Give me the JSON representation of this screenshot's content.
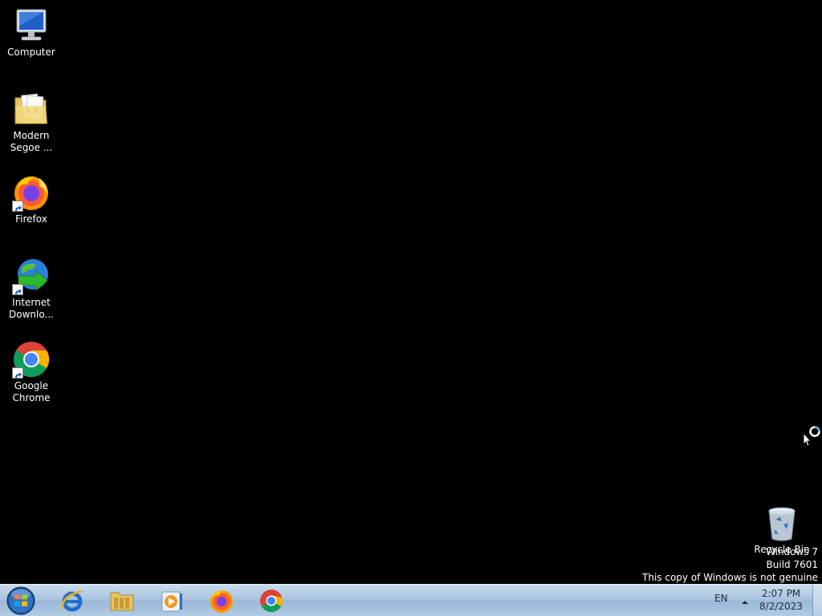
{
  "desktop_icons": [
    {
      "label": "Computer",
      "icon": "computer-icon"
    },
    {
      "label": "Modern\nSegoe ...",
      "icon": "folder-icon"
    },
    {
      "label": "Firefox",
      "icon": "firefox-icon"
    },
    {
      "label": "Internet\nDownlo...",
      "icon": "internet-download-manager-icon"
    },
    {
      "label": "Google\nChrome",
      "icon": "chrome-icon"
    },
    {
      "label": "Recycle Bin",
      "icon": "recycle-bin-icon"
    }
  ],
  "watermark": {
    "line1": "Windows 7",
    "line2": "Build 7601",
    "line3": "This copy of Windows is not genuine"
  },
  "taskbar": {
    "start": "start-orb-icon",
    "pinned": [
      {
        "name": "internet-explorer",
        "icon": "internet-explorer-icon"
      },
      {
        "name": "windows-explorer",
        "icon": "folder-icon"
      },
      {
        "name": "media-player",
        "icon": "media-player-icon"
      },
      {
        "name": "firefox",
        "icon": "firefox-icon"
      },
      {
        "name": "chrome",
        "icon": "chrome-icon"
      }
    ],
    "tray": {
      "language": "EN",
      "time": "2:07 PM",
      "date": "8/2/2023"
    }
  },
  "colors": {
    "desktop_background": "#000000",
    "taskbar": "#a9c4df"
  }
}
